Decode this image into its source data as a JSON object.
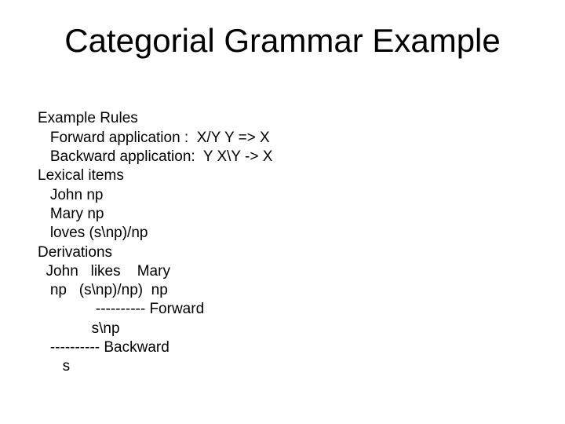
{
  "title": "Categorial Grammar Example",
  "lines": {
    "l0": "Example Rules",
    "l1": "   Forward application :  X/Y Y => X",
    "l2": "   Backward application:  Y X\\Y -> X",
    "l3": "Lexical items",
    "l4": "   John np",
    "l5": "   Mary np",
    "l6": "   loves (s\\np)/np",
    "l7": "Derivations",
    "l8": "  John   likes    Mary",
    "l9": "   np   (s\\np)/np)  np",
    "l10": "              ---------- Forward",
    "l11": "             s\\np",
    "l12": "   ---------- Backward",
    "l13": "      s"
  }
}
